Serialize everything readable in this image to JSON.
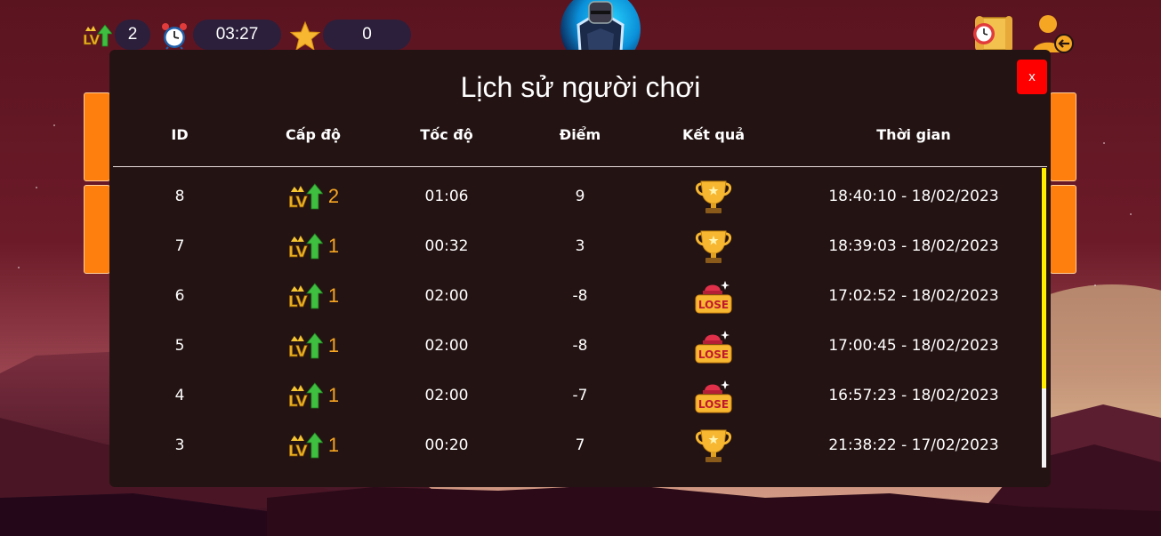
{
  "hud": {
    "level_value": "2",
    "time_value": "03:27",
    "score_value": "0"
  },
  "modal": {
    "title": "Lịch sử người chơi",
    "close_label": "x",
    "columns": [
      "ID",
      "Cấp độ",
      "Tốc độ",
      "Điểm",
      "Kết quả",
      "Thời gian"
    ]
  },
  "rows": [
    {
      "id": "8",
      "level": "2",
      "speed": "01:06",
      "score": "9",
      "result": "win",
      "time": "18:40:10 - 18/02/2023"
    },
    {
      "id": "7",
      "level": "1",
      "speed": "00:32",
      "score": "3",
      "result": "win",
      "time": "18:39:03 - 18/02/2023"
    },
    {
      "id": "6",
      "level": "1",
      "speed": "02:00",
      "score": "-8",
      "result": "lose",
      "time": "17:02:52 - 18/02/2023"
    },
    {
      "id": "5",
      "level": "1",
      "speed": "02:00",
      "score": "-8",
      "result": "lose",
      "time": "17:00:45 - 18/02/2023"
    },
    {
      "id": "4",
      "level": "1",
      "speed": "02:00",
      "score": "-7",
      "result": "lose",
      "time": "16:57:23 - 18/02/2023"
    },
    {
      "id": "3",
      "level": "1",
      "speed": "00:20",
      "score": "7",
      "result": "win",
      "time": "21:38:22 - 17/02/2023"
    }
  ],
  "result_icons": {
    "win": "trophy-icon",
    "lose": "lose-badge-icon"
  },
  "lose_badge_text": "LOSE",
  "colors": {
    "accent": "#f5a623",
    "close": "#ff0000",
    "panel": "#ff7f0e",
    "scroll_thumb": "#ffee00",
    "modal_bg": "#241313"
  }
}
